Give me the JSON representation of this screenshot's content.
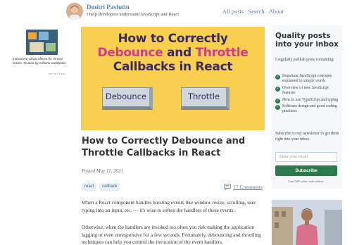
{
  "header": {
    "author_name": "Dmitri Pavlutin",
    "tagline": "I help developers understand JavaScript and React",
    "nav": [
      "All posts",
      "Search",
      "About"
    ]
  },
  "ad": {
    "text": "Interactive virtual offices for remote teams. Trusted by millions worldwide.",
    "meta": "ads via Carbon"
  },
  "hero": {
    "line1": "How to Correctly",
    "line2_a": "Debounce",
    "line2_b": "and",
    "line2_c": "Throttle",
    "line3": "Callbacks in React",
    "key1": "Debounce",
    "key2": "Throttle",
    "colors": {
      "background": "#f8cf4e",
      "accent": "#d23a8d",
      "dark": "#3a2a63"
    }
  },
  "article": {
    "title": "How to Correctly Debounce and Throttle Callbacks in React",
    "posted": "Posted May 11, 2021",
    "tags": [
      "react",
      "callback"
    ],
    "comments": "17 Comments",
    "p1": "When a React component handles bursting events like window resize, scrolling, user typing into an input, etc. — it's wise to soften the handlers of these events.",
    "p2": "Otherwise, when the handlers are invoked too often you risk making the application lagging or even unresponsive for a few seconds. Fortunately, debouncing and throttling techniques can help you control the invocation of the event handlers."
  },
  "sidebar": {
    "heading": "Quality posts into your inbox",
    "intro": "I regularly publish posts containing:",
    "features": [
      "Important JavaScript concepts explained in simple words",
      "Overview of new JavaScript features",
      "How to use TypeScript and typing",
      "Software design and good coding practices"
    ],
    "subscribe_text": "Subscribe to my newsletter to get them right into your inbox.",
    "email_placeholder": "Enter your email",
    "subscribe_button": "Subscribe",
    "join_text": "Join 52% other subscribers."
  },
  "colors": {
    "link": "#5a7fa6",
    "green": "#2c7a4b"
  }
}
